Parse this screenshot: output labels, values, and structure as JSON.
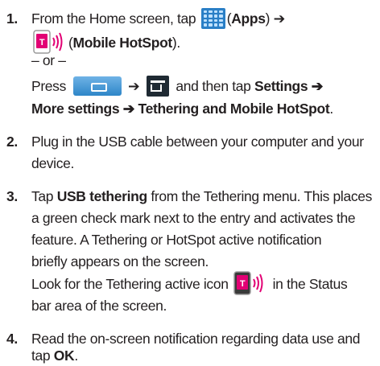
{
  "steps": [
    {
      "number": "1.",
      "line1_a": "From the Home screen, tap",
      "line1_b": "(",
      "line1_apps": "Apps",
      "line1_c": ") ➔",
      "line2_open": "(",
      "line2_bold": "Mobile HotSpot",
      "line2_close": ").",
      "or": "– or –",
      "press_a": "Press",
      "arrow": "➔",
      "press_b": "and then tap",
      "settings": "Settings ➔",
      "path": "More settings ➔ Tethering and Mobile HotSpot",
      "period": "."
    },
    {
      "number": "2.",
      "line1": "Plug in the USB cable between your computer and your",
      "line2": "device."
    },
    {
      "number": "3.",
      "tap": "Tap",
      "bold": "USB tethering",
      "line1_rest": "from the Tethering menu. This places",
      "line2": "a green check mark next to the entry and activates the",
      "line3": "feature. A Tethering or HotSpot active notification",
      "line4": "briefly appears on the screen.",
      "line5_a": "Look for the Tethering active icon",
      "line5_b": "in the Status",
      "line6": "bar area of the screen."
    },
    {
      "number": "4.",
      "line1": "Read the on-screen notification regarding data use and",
      "line2_a": "tap",
      "line2_bold": "OK",
      "line2_b": "."
    }
  ],
  "icons": {
    "apps": "apps-grid-icon",
    "mobile_hotspot": "t-mobile-hotspot-icon",
    "home_key": "home-key-icon",
    "menu_key": "menu-key-icon",
    "tethering_active": "tethering-active-icon"
  },
  "colors": {
    "text": "#231f20",
    "apps_icon": "#2a7fc6",
    "tmobile_magenta": "#e20074"
  }
}
